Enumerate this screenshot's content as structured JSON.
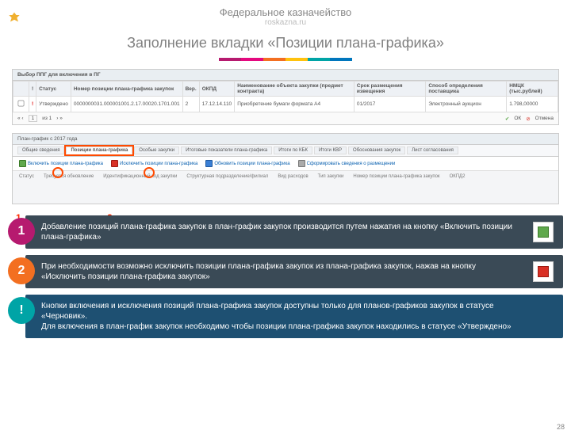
{
  "header": {
    "org": "Федеральное казначейство",
    "url": "roskazna.ru",
    "title": "Заполнение вкладки «Позиции плана-графика»"
  },
  "color_bar": [
    "#b61a6f",
    "#e4097f",
    "#f36f21",
    "#ffc20e",
    "#00a4a6",
    "#0076bd"
  ],
  "dialog": {
    "title": "Выбор ППГ для включения в ПГ",
    "cols": {
      "c0": "",
      "c1": "!",
      "c2": "Статус",
      "c3": "Номер позиции плана-графика закупок",
      "c4": "Вер.",
      "c5": "ОКПД",
      "c6": "Наименование объекта закупки (предмет контракта)",
      "c7": "Срок размещения извещения",
      "c8": "Способ определения поставщика",
      "c9": "НМЦК (тыс.рублей)"
    },
    "row": {
      "r1": "!",
      "r2": "Утверждено",
      "r3": "0000000031.000001001.2.17.00020.1701.001",
      "r4": "2",
      "r5": "17.12.14.110",
      "r6": "Приобретение бумаги формата А4",
      "r7": "01/2017",
      "r8": "Электронный аукцион",
      "r9": "1.798,00000"
    },
    "footer": {
      "page": "1",
      "of": "из 1",
      "ok": "ОК",
      "cancel": "Отмена"
    }
  },
  "lower": {
    "bar": "План-график с 2017 года",
    "tabs": {
      "t0": "Общие сведения",
      "t1": "Позиции плана-графика",
      "t2": "Особые закупки",
      "t3": "Итоговые показатели плана-графика",
      "t4": "Итоги по КБК",
      "t5": "Итоги КВР",
      "t6": "Обоснования закупок",
      "t7": "Лист согласования"
    },
    "tools": {
      "a": "Включить позиции плана-графика",
      "b": "Исключить позиции плана-графика",
      "c": "Обновить позиции плана-графика",
      "d": "Сформировать сведения о размещении"
    },
    "cols": {
      "a": "Статус",
      "b": "Требуется обновление",
      "c": "Идентификационный код закупки",
      "d": "Структурная подразделение/филиал",
      "e": "Вид расходов",
      "f": "Тип закупки",
      "g": "Номер позиции плана-графика закупок",
      "h": "ОКПД2"
    }
  },
  "marks": {
    "n1": "1",
    "n2": "2"
  },
  "callouts": {
    "c1": {
      "num": "1",
      "text": "Добавление позиций плана-графика закупок в план-график закупок производится путем нажатия на кнопку «Включить позиции плана-графика»"
    },
    "c2": {
      "num": "2",
      "text": "При необходимости возможно исключить позиции плана-графика закупок из плана-графика закупок, нажав на кнопку «Исключить позиции плана-графика закупок»"
    },
    "c3": {
      "num": "!",
      "text": "Кнопки включения и исключения позиций плана-графика закупок доступны только для планов-графиков закупок в статусе «Черновик».\nДля включения в план-график закупок необходимо чтобы позиции плана-графика закупок находились в статусе «Утверждено»"
    }
  },
  "page_number": "28"
}
